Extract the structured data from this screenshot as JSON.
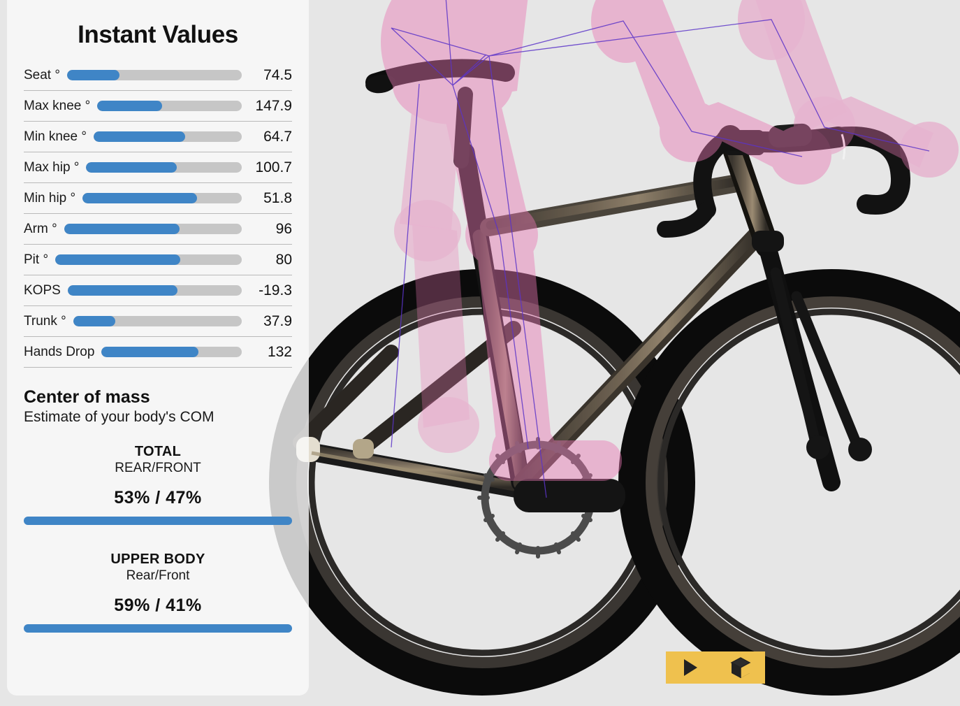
{
  "panel": {
    "title": "Instant Values",
    "metrics": [
      {
        "label": "Seat °",
        "value": "74.5",
        "fill_pct": 30
      },
      {
        "label": "Max knee °",
        "value": "147.9",
        "fill_pct": 45
      },
      {
        "label": "Min knee °",
        "value": "64.7",
        "fill_pct": 62
      },
      {
        "label": "Max hip °",
        "value": "100.7",
        "fill_pct": 58
      },
      {
        "label": "Min hip °",
        "value": "51.8",
        "fill_pct": 72
      },
      {
        "label": "Arm °",
        "value": "96",
        "fill_pct": 65
      },
      {
        "label": "Pit °",
        "value": "80",
        "fill_pct": 67
      },
      {
        "label": "KOPS",
        "value": "-19.3",
        "fill_pct": 63
      },
      {
        "label": "Trunk °",
        "value": "37.9",
        "fill_pct": 25
      },
      {
        "label": "Hands Drop",
        "value": "132",
        "fill_pct": 69
      }
    ],
    "com": {
      "heading": "Center of mass",
      "subheading": "Estimate of your body's COM",
      "total": {
        "title": "TOTAL",
        "axis_label": "REAR/FRONT",
        "split": "53%  /  47%",
        "rear_pct": 53,
        "front_pct": 47
      },
      "upper_body": {
        "title": "UPPER BODY",
        "axis_label": "Rear/Front",
        "split": "59%  /  41%",
        "rear_pct": 59,
        "front_pct": 41
      }
    }
  },
  "toolbar": {
    "play_icon": "play-icon",
    "cube_icon": "cube-3d-icon",
    "background_color": "#efc14e"
  },
  "scene": {
    "description": "3D bike fit visualization",
    "background_color": "#e6e6e6",
    "rider_color": "#f09ccd",
    "frame_color": "#5a5046",
    "tire_color": "#111111",
    "accent_color": "#3f85c6"
  }
}
